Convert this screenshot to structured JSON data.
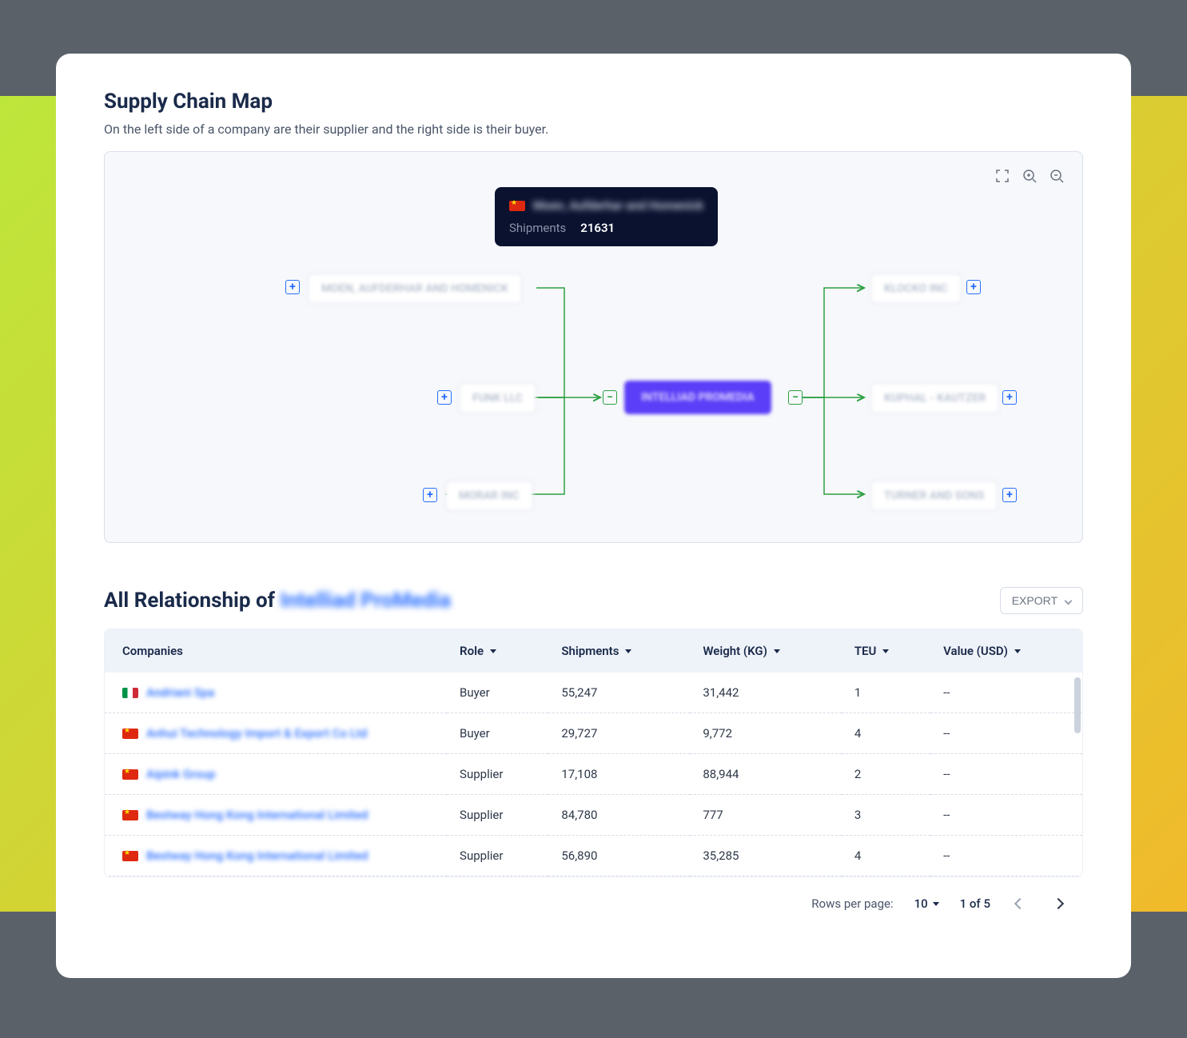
{
  "title": "Supply Chain Map",
  "subtitle": "On the left side of a company are their supplier and the right side is their buyer.",
  "tooltip": {
    "flag": "cn",
    "name": "Moen, Aufderhar and Homenick",
    "shipments_label": "Shipments",
    "shipments_value": "21631"
  },
  "nodes": {
    "center": "INTELLIAD PROMEDIA",
    "suppliers": [
      "MOEN, AUFDERHAR AND HOMENICK",
      "FUNK LLC",
      "MORAR INC"
    ],
    "buyers": [
      "KLOCKO INC",
      "KUPHAL - KAUTZER",
      "TURNER AND SONS"
    ]
  },
  "relationship": {
    "title_prefix": "All Relationship of ",
    "title_highlight": "Intelliad ProMedia",
    "export_label": "EXPORT"
  },
  "columns": {
    "companies": "Companies",
    "role": "Role",
    "shipments": "Shipments",
    "weight": "Weight (KG)",
    "teu": "TEU",
    "value": "Value (USD)"
  },
  "rows": [
    {
      "flag": "it",
      "company": "Andriani Spa",
      "role": "Buyer",
      "shipments": "55,247",
      "weight": "31,442",
      "teu": "1",
      "value": "--"
    },
    {
      "flag": "cn",
      "company": "Anhui Technology Import & Export Co Ltd",
      "role": "Buyer",
      "shipments": "29,727",
      "weight": "9,772",
      "teu": "4",
      "value": "--"
    },
    {
      "flag": "cn",
      "company": "Aipink Group",
      "role": "Supplier",
      "shipments": "17,108",
      "weight": "88,944",
      "teu": "2",
      "value": "--"
    },
    {
      "flag": "cn",
      "company": "Bestway Hong Kong International Limited",
      "role": "Supplier",
      "shipments": "84,780",
      "weight": "777",
      "teu": "3",
      "value": "--"
    },
    {
      "flag": "cn",
      "company": "Bestway Hong Kong International Limited",
      "role": "Supplier",
      "shipments": "56,890",
      "weight": "35,285",
      "teu": "4",
      "value": "--"
    }
  ],
  "pagination": {
    "rows_label": "Rows per page:",
    "rows_value": "10",
    "page_text": "1 of 5"
  }
}
